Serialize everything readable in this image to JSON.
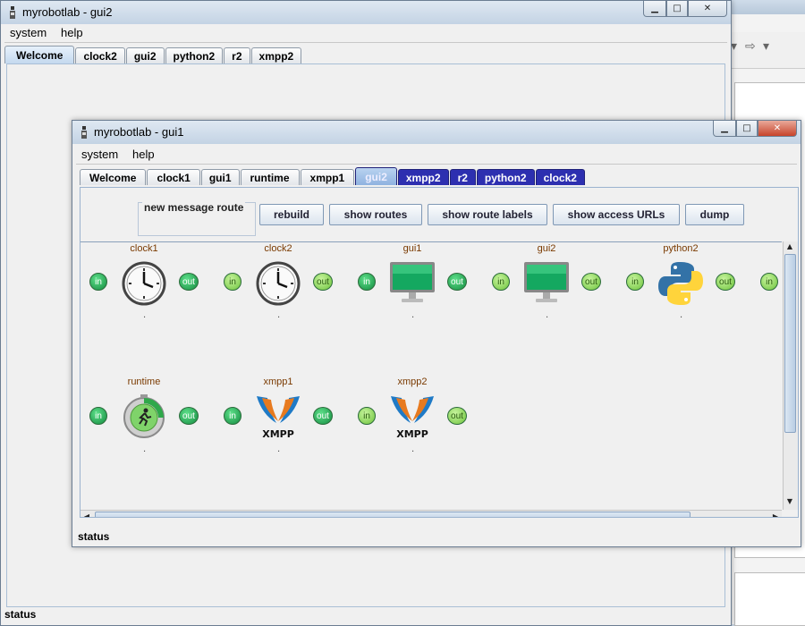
{
  "back_window": {
    "title": "myrobotlab - gui2",
    "menu": [
      "system",
      "help"
    ],
    "tabs": [
      "Welcome",
      "clock2",
      "gui2",
      "python2",
      "r2",
      "xmpp2"
    ],
    "selected_tab": "Welcome",
    "status": "status"
  },
  "front_window": {
    "title": "myrobotlab - gui1",
    "menu": [
      "system",
      "help"
    ],
    "tabs": [
      "Welcome",
      "clock1",
      "gui1",
      "runtime",
      "xmpp1",
      "gui2",
      "xmpp2",
      "r2",
      "python2",
      "clock2"
    ],
    "remote_tabs": [
      "gui2",
      "xmpp2",
      "r2",
      "python2",
      "clock2"
    ],
    "selected_tab": "gui2",
    "route_label": "new message route",
    "buttons": [
      "rebuild",
      "show routes",
      "show route labels",
      "show access URLs",
      "dump"
    ],
    "services_row1": [
      {
        "name": "clock1",
        "icon": "clock-icon",
        "in_style": "dark",
        "out_style": "dark"
      },
      {
        "name": "clock2",
        "icon": "clock-icon",
        "in_style": "light",
        "out_style": "light"
      },
      {
        "name": "gui1",
        "icon": "monitor-icon",
        "in_style": "dark",
        "out_style": "dark"
      },
      {
        "name": "gui2",
        "icon": "monitor-icon",
        "in_style": "light",
        "out_style": "light"
      },
      {
        "name": "python2",
        "icon": "python-icon",
        "in_style": "light",
        "out_style": "light"
      }
    ],
    "services_row2": [
      {
        "name": "runtime",
        "icon": "runtime-icon",
        "in_style": "dark",
        "out_style": "dark"
      },
      {
        "name": "xmpp1",
        "icon": "xmpp-icon",
        "in_style": "dark",
        "out_style": "dark"
      },
      {
        "name": "xmpp2",
        "icon": "xmpp-icon",
        "in_style": "light",
        "out_style": "light"
      }
    ],
    "port_in": "in",
    "port_out": "out",
    "status": "status"
  },
  "colors": {
    "remote_tab": "#2d2fb0",
    "port_dark": "#138a3f",
    "port_light": "#6cc23b",
    "service_name": "#7a3a00"
  }
}
